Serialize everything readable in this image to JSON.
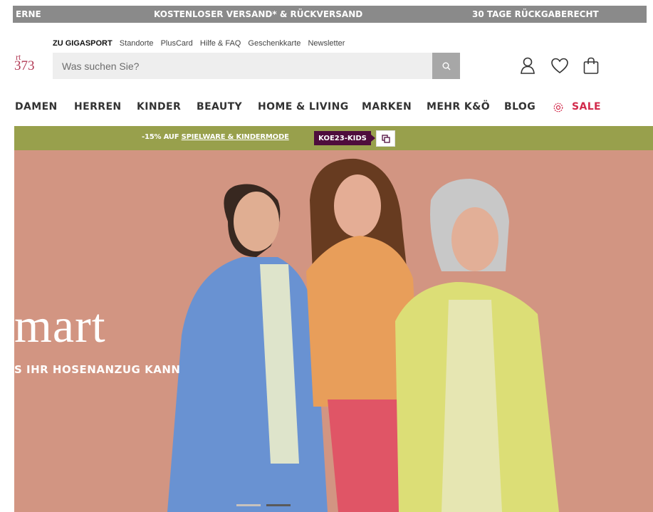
{
  "promo_bar": {
    "left": "ERNE",
    "center": "KOSTENLOSER VERSAND* & RÜCKVERSAND",
    "right": "30 TAGE RÜCKGABERECHT"
  },
  "utility_links": {
    "gigasport": "ZU GIGASPORT",
    "items": [
      "Standorte",
      "PlusCard",
      "Hilfe & FAQ",
      "Geschenkkarte",
      "Newsletter"
    ]
  },
  "logo": {
    "line1": "rt",
    "line2": "373"
  },
  "search": {
    "placeholder": "Was suchen Sie?"
  },
  "header_icons": [
    "account-icon",
    "heart-icon",
    "bag-icon"
  ],
  "main_nav": {
    "items": [
      "DAMEN",
      "HERREN",
      "KINDER",
      "BEAUTY",
      "HOME & LIVING",
      "MARKEN",
      "MEHR K&Ö",
      "BLOG"
    ],
    "sale": "SALE"
  },
  "campaign": {
    "prefix": "-15% AUF ",
    "link": "SPIELWARE & KINDERMODE",
    "code": "KOE23-KIDS"
  },
  "hero": {
    "title": "mart",
    "subtitle": "S IHR HOSENANZUG KANN"
  },
  "colors": {
    "promo_bar": "#8a8a8a",
    "campaign_bar": "#98a04c",
    "code_badge": "#4e0c3c",
    "sale": "#d22a4b",
    "hero_background": "#d99a87"
  }
}
